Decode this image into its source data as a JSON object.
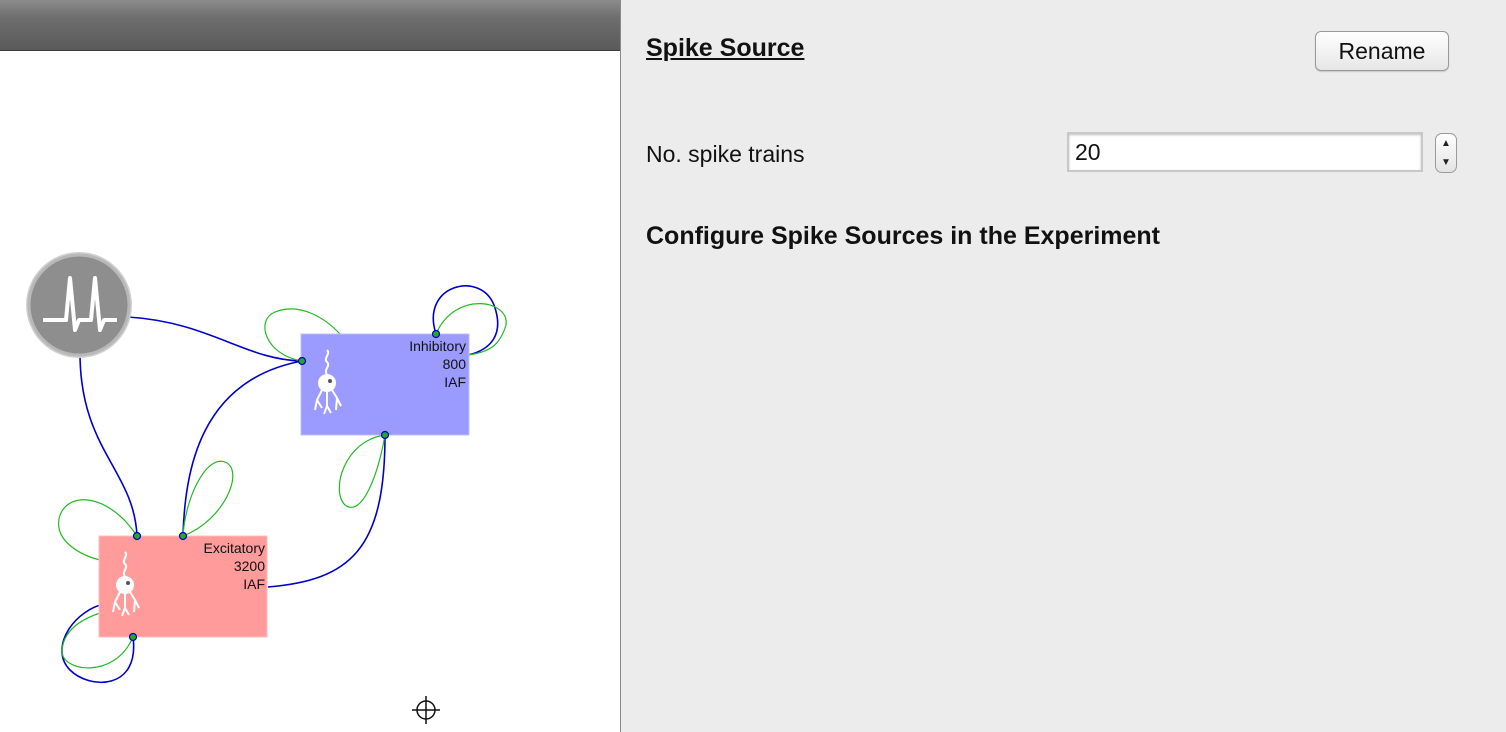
{
  "network": {
    "spike_source": {
      "icon": "spike-train-icon"
    },
    "populations": [
      {
        "id": "inhibitory",
        "name": "Inhibitory",
        "size": "800",
        "model": "IAF",
        "color": "#9b9bff",
        "icon": "neuron-icon"
      },
      {
        "id": "excitatory",
        "name": "Excitatory",
        "size": "3200",
        "model": "IAF",
        "color": "#ff9b9b",
        "icon": "neuron-icon"
      }
    ],
    "colors": {
      "source_projection": "#0000cc",
      "loop_projection": "#22bb22",
      "port": "#22aa22"
    },
    "cursor_icon": "crosshair-icon"
  },
  "panel": {
    "title": "Spike Source",
    "rename_label": "Rename",
    "trains_label": "No. spike trains",
    "trains_value": "20",
    "configure_heading": "Configure Spike Sources in the Experiment"
  }
}
